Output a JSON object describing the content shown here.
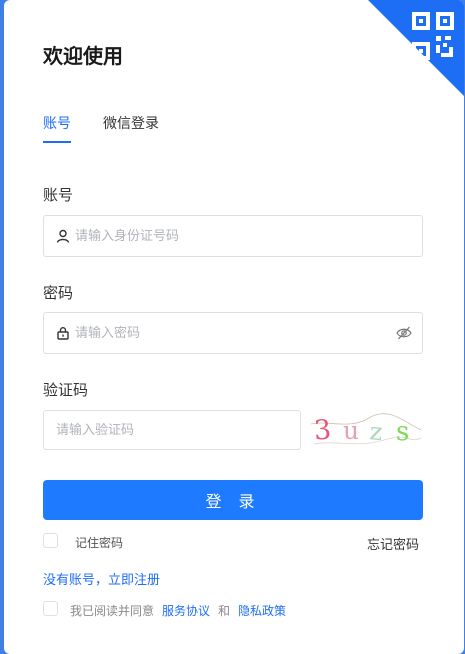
{
  "title": "欢迎使用",
  "tabs": [
    {
      "label": "账号",
      "active": true
    },
    {
      "label": "微信登录",
      "active": false
    }
  ],
  "account": {
    "label": "账号",
    "placeholder": "请输入身份证号码",
    "icon": "user-icon"
  },
  "password": {
    "label": "密码",
    "placeholder": "请输入密码",
    "icon": "lock-icon",
    "toggle_icon": "eye-off-icon"
  },
  "captcha": {
    "label": "验证码",
    "placeholder": "请输入验证码",
    "chars": [
      "3",
      "u",
      "z",
      "s"
    ],
    "colors": [
      "#e8557a",
      "#e8a0b0",
      "#a8d8b8",
      "#7ed957"
    ]
  },
  "login_button": "登 录",
  "remember_password": "记住密码",
  "forgot_password": "忘记密码",
  "register_link": "没有账号，立即注册",
  "agreement": {
    "prefix": "我已阅读并同意",
    "service_agreement": "服务协议",
    "and": "和",
    "privacy_policy": "隐私政策"
  },
  "colors": {
    "primary": "#1e6ef5",
    "button": "#1e7bff",
    "background": "#3f7fe6"
  }
}
